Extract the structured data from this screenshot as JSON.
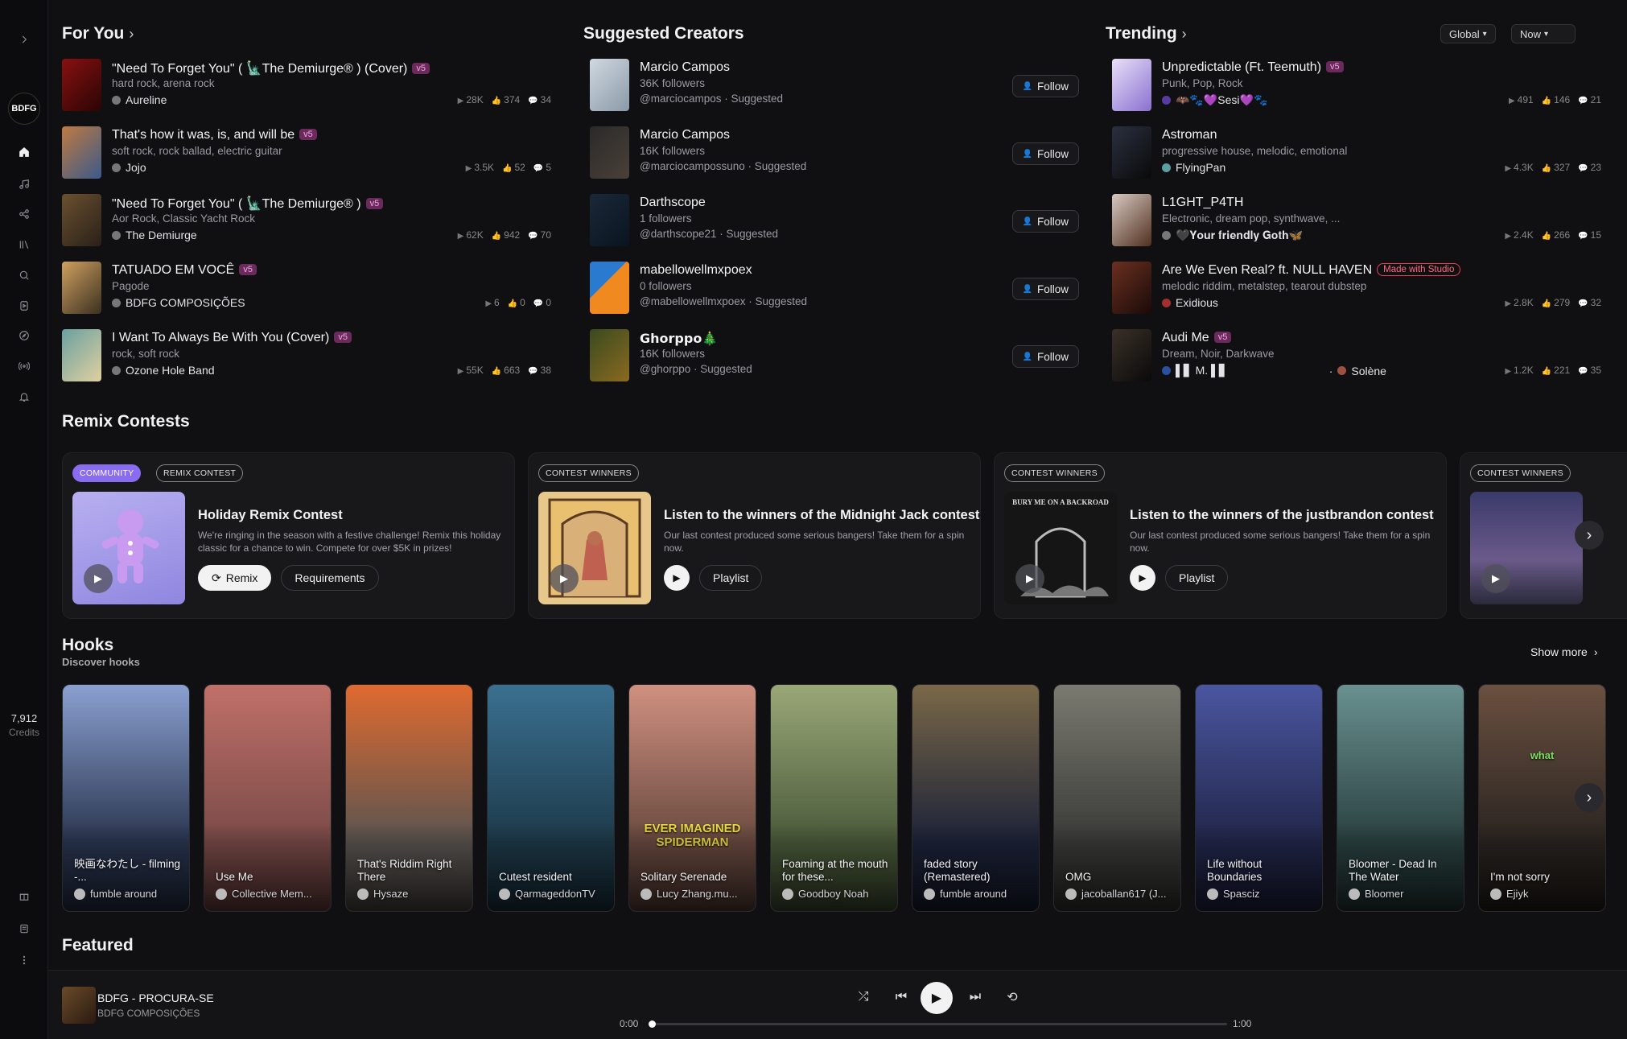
{
  "sidebar": {
    "avatar_text": "BDFG",
    "credits_count": "7,912",
    "credits_label": "Credits",
    "icons": [
      "expand-icon",
      "home-icon",
      "create-icon",
      "remix-icon",
      "library-icon",
      "search-icon",
      "hooks-icon",
      "explore-icon",
      "radio-icon",
      "notifications-icon",
      "gift-icon",
      "feed-icon",
      "more-icon"
    ]
  },
  "for_you": {
    "title": "For You",
    "rows": [
      {
        "title": "\"Need To Forget You\" ( 🗽The Demiurge® ) (Cover)",
        "badge": "v5",
        "genres": "hard rock, arena rock",
        "artist": "Aureline",
        "plays": "28K",
        "likes": "374",
        "comments": "34"
      },
      {
        "title": "That's how it was, is, and will be",
        "badge": "v5",
        "genres": "soft rock, rock ballad, electric guitar",
        "artist": "Jojo",
        "plays": "3.5K",
        "likes": "52",
        "comments": "5"
      },
      {
        "title": "\"Need To Forget You\" ( 🗽The Demiurge® )",
        "badge": "v5",
        "genres": "Aor Rock, Classic Yacht Rock",
        "artist": "The Demiurge",
        "plays": "62K",
        "likes": "942",
        "comments": "70"
      },
      {
        "title": "TATUADO EM VOCÊ",
        "badge": "v5",
        "genres": "Pagode",
        "artist": "BDFG COMPOSIÇÕES",
        "plays": "6",
        "likes": "0",
        "comments": "0"
      },
      {
        "title": "I Want To Always Be With You (Cover)",
        "badge": "v5",
        "genres": "rock, soft rock",
        "artist": "Ozone Hole Band",
        "plays": "55K",
        "likes": "663",
        "comments": "38"
      }
    ]
  },
  "suggested": {
    "title": "Suggested Creators",
    "follow_label": "Follow",
    "rows": [
      {
        "name": "Marcio Campos",
        "followers": "36K followers",
        "handle": "@marciocampos · Suggested"
      },
      {
        "name": "Marcio Campos",
        "followers": "16K followers",
        "handle": "@marciocampossuno · Suggested"
      },
      {
        "name": "Darthscope",
        "followers": "1 followers",
        "handle": "@darthscope21 · Suggested"
      },
      {
        "name": "mabellowellmxpoex",
        "followers": "0 followers",
        "handle": "@mabellowellmxpoex · Suggested"
      },
      {
        "name": "𝗚𝗵𝗼𝗿𝗽𝗽𝗼🎄",
        "followers": "16K followers",
        "handle": "@ghorppo · Suggested"
      }
    ]
  },
  "trending": {
    "title": "Trending",
    "filter_region": "Global",
    "filter_time": "Now",
    "rows": [
      {
        "title": "Unpredictable (Ft. Teemuth)",
        "badge": "v5",
        "studio": "",
        "genres": "Punk, Pop, Rock",
        "artist": "🦇🐾💜Sesi💜🐾",
        "plays": "491",
        "likes": "146",
        "comments": "21"
      },
      {
        "title": "Astroman",
        "badge": "",
        "studio": "",
        "genres": "progressive house, melodic, emotional",
        "artist": "FlyingPan",
        "plays": "4.3K",
        "likes": "327",
        "comments": "23"
      },
      {
        "title": "L1GHT_P4TH",
        "badge": "",
        "studio": "",
        "genres": "Electronic, dream pop, synthwave, ...",
        "artist": "🖤𝐘𝐨𝐮𝐫 𝐟𝐫𝐢𝐞𝐧𝐝𝐥𝐲 𝐆𝐨𝐭𝐡🦋",
        "plays": "2.4K",
        "likes": "266",
        "comments": "15"
      },
      {
        "title": "Are We Even Real? ft. NULL HAVEN",
        "badge": "",
        "studio": "Made with Studio",
        "genres": "melodic riddim, metalstep, tearout dubstep",
        "artist": "Exidious",
        "plays": "2.8K",
        "likes": "279",
        "comments": "32"
      },
      {
        "title": "Audi Me",
        "badge": "v5",
        "studio": "",
        "genres": "Dream, Noir, Darkwave",
        "artist": "▌▋ M. ▌▋",
        "artist2": "Solène",
        "plays": "1.2K",
        "likes": "221",
        "comments": "35"
      }
    ]
  },
  "remix": {
    "title": "Remix Contests",
    "cards": [
      {
        "chips": [
          "COMMUNITY",
          "REMIX CONTEST"
        ],
        "title": "Holiday Remix Contest",
        "desc": "We're ringing in the season with a festive challenge! Remix this holiday classic for a chance to win. Compete for over $5K in prizes!",
        "btn1": "Remix",
        "btn2": "Requirements"
      },
      {
        "chips": [
          "CONTEST WINNERS"
        ],
        "title": "Listen to the winners of the Midnight Jack contest",
        "desc": "Our last contest produced some serious bangers! Take them for a spin now.",
        "btn2": "Playlist"
      },
      {
        "chips": [
          "CONTEST WINNERS"
        ],
        "title": "Listen to the winners of the justbrandon contest",
        "desc": "Our last contest produced some serious bangers! Take them for a spin now.",
        "btn2": "Playlist",
        "art_text": "BURY ME ON A BACKROAD"
      },
      {
        "chips": [
          "CONTEST WINNERS"
        ]
      }
    ]
  },
  "hooks": {
    "title": "Hooks",
    "subtitle": "Discover hooks",
    "show_more": "Show more",
    "items": [
      {
        "title": "映画なわたし - filming -...",
        "artist": "fumble around",
        "bg": "#2a3550",
        "accent": "#8aa0d0"
      },
      {
        "title": "Use Me",
        "artist": "Collective Mem...",
        "bg": "#7a4a48",
        "accent": "#c07068"
      },
      {
        "title": "That's Riddim Right There",
        "artist": "Hysaze",
        "bg": "#5a5450",
        "accent": "#e06a30"
      },
      {
        "title": "Cutest resident",
        "artist": "QarmageddonTV",
        "bg": "#1e3a4a",
        "accent": "#3a7090"
      },
      {
        "title": "Solitary Serenade",
        "artist": "Lucy Zhang.mu...",
        "bg": "#6a4a40",
        "accent": "#d09080",
        "overlay": "EVER IMAGINED SPIDERMAN"
      },
      {
        "title": "Foaming at the mouth for these...",
        "artist": "Goodboy Noah",
        "bg": "#4a5a3a",
        "accent": "#9aa878"
      },
      {
        "title": "faded story (Remastered)",
        "artist": "fumble around",
        "bg": "#1c2238",
        "accent": "#7a6848"
      },
      {
        "title": "OMG",
        "artist": "jacoballan617 (J...",
        "bg": "#3a3a38",
        "accent": "#7a7a70"
      },
      {
        "title": "Life without Boundaries",
        "artist": "Spasciz",
        "bg": "#22264a",
        "accent": "#4a56a0"
      },
      {
        "title": "Bloomer - Dead In The Water",
        "artist": "Bloomer",
        "bg": "#2a4040",
        "accent": "#6a9090"
      },
      {
        "title": "I'm not sorry",
        "artist": "Ejiyk",
        "bg": "#2a2420",
        "accent": "#6a5040",
        "overlay": "what"
      }
    ]
  },
  "featured": {
    "title": "Featured"
  },
  "player": {
    "title": "BDFG - PROCURA-SE",
    "artist": "BDFG COMPOSIÇÕES",
    "time_current": "0:00",
    "time_total": "1:00",
    "progress": 0.0
  }
}
